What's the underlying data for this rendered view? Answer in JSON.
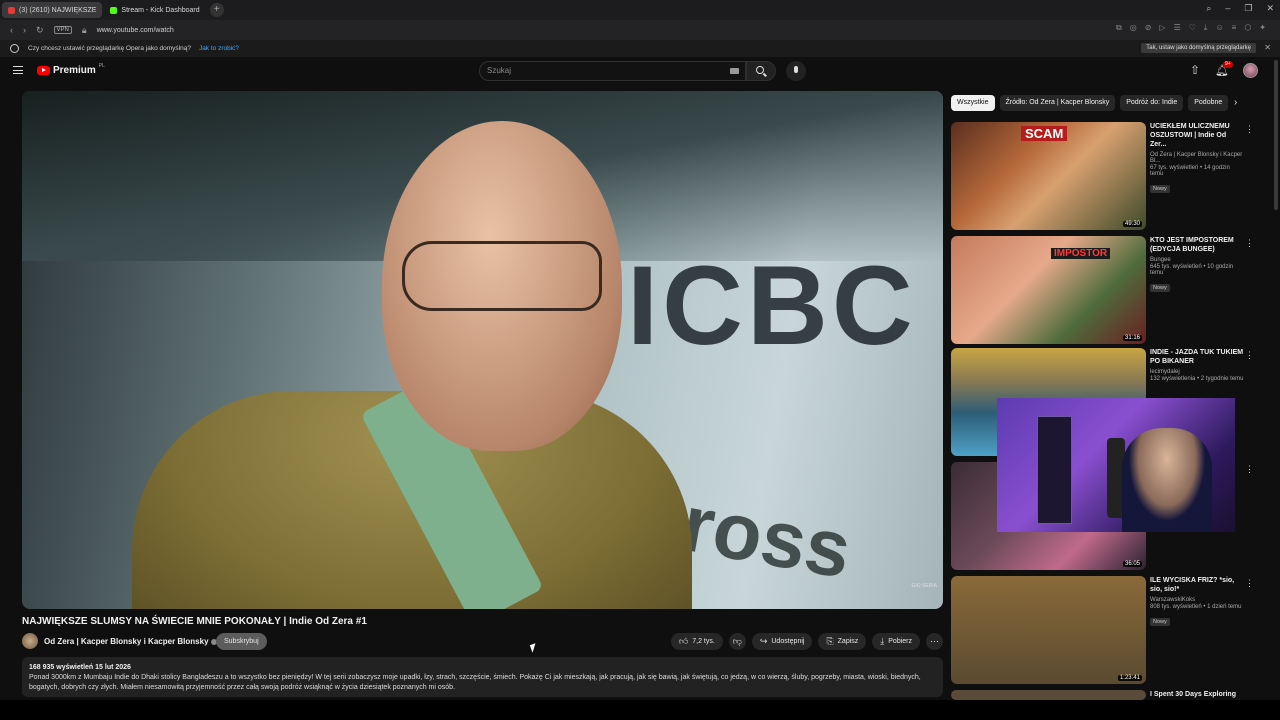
{
  "browser": {
    "tabs": [
      {
        "label": "(3) (2610) NAJWIĘKSZE"
      },
      {
        "label": "Stream - Kick Dashboard"
      }
    ],
    "url": "www.youtube.com/watch",
    "vpn_label": "VPN",
    "infobar": {
      "question": "Czy chcesz ustawić przeglądarkę Opera jako domyślną?",
      "link": "Jak to zrobić?",
      "button": "Tak, ustaw jako domyślną przeglądarkę"
    }
  },
  "header": {
    "logo_text": "Premium",
    "logo_region": "PL",
    "search_placeholder": "Szukaj",
    "notif_badge": "9+"
  },
  "video": {
    "sign_text": "ICBC",
    "sign_text2": "ross",
    "watermark": "GIO SERIA",
    "title": "NAJWIĘKSZE SLUMSY NA ŚWIECIE MNIE POKONAŁY | Indie Od Zera #1",
    "channel": "Od Zera | Kacper Blonsky i Kacper Blonsky",
    "subscribe": "Subskrybuj",
    "likes": "7,2 tys.",
    "share": "Udostępnij",
    "save": "Zapisz",
    "download": "Pobierz",
    "views_date": "168 935 wyświetleń  15 lut 2026",
    "description": "Ponad 3000km z Mumbaju Indie do Dhaki stolicy Bangladeszu a to wszystko bez pieniędzy! W tej serii zobaczysz moje upadki, łzy, strach, szczęście, śmiech. Pokażę Ci jak mieszkają, jak pracują, jak się bawią, jak świętują, co jedzą, w co wierzą, śluby, pogrzeby, miasta, wioski, biednych, bogatych, dobrych czy złych. Miałem niesamowitą przyjemność przez całą swoją podróż wsiąknąć w życia dziesiątek poznanych mi osób."
  },
  "chips": [
    "Wszystkie",
    "Źródło: Od Zera | Kacper Blonsky",
    "Podróż do: Indie",
    "Podobne"
  ],
  "recommendations": [
    {
      "title": "UCIEKŁEM ULICZNEMU OSZUSTOWI | Indie Od Zer...",
      "channel": "Od Zera | Kacper Blonsky i Kacper Bl...",
      "views": "67 tys. wyświetleń • 14 godzin temu",
      "badge": "Nowy",
      "duration": "49:30",
      "thumb_text": "SCAM"
    },
    {
      "title": "KTO JEST IMPOSTOREM (EDYCJA BUNGEE)",
      "channel": "Bungee",
      "views": "645 tys. wyświetleń • 10 godzin temu",
      "badge": "Nowy",
      "duration": "31:16",
      "thumb_text": "IMPOSTOR"
    },
    {
      "title": "INDIE - JAZDA TUK TUKIEM PO BIKANER",
      "channel": "lecimydalej",
      "views": "132 wyświetlenia • 2 tygodnie temu",
      "badge": "",
      "duration": "",
      "thumb_text": ""
    },
    {
      "title": "",
      "channel": "",
      "views": "",
      "badge": "",
      "duration": "36:05",
      "thumb_text": ""
    },
    {
      "title": "ILE WYCISKA FRIZ? *sio, sio, sio!*",
      "channel": "WarszawskiKoks",
      "views": "808 tys. wyświetleń • 1 dzień temu",
      "badge": "Nowy",
      "duration": "1:23:41",
      "thumb_text": ""
    },
    {
      "title": "I Spent 30 Days Exploring",
      "channel": "",
      "views": "",
      "badge": "",
      "duration": "",
      "thumb_text": ""
    }
  ]
}
